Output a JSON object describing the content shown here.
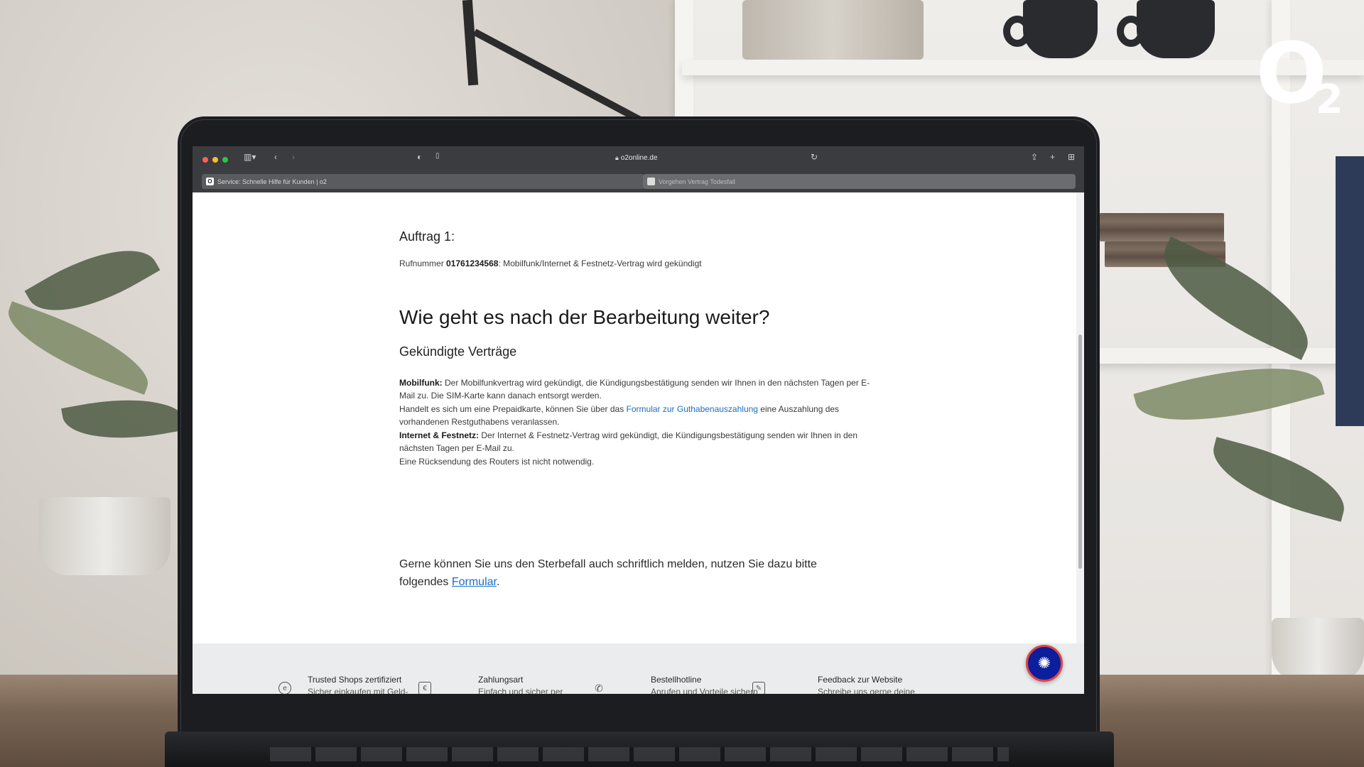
{
  "brand": {
    "logo_letter": "O",
    "logo_subscript": "2",
    "accent_color": "#0b1e9c",
    "link_color": "#1a6ec2"
  },
  "browser": {
    "address": "o2online.de",
    "tabs": [
      {
        "label": "Service: Schnelle Hilfe für Kunden | o2",
        "favicon": "O"
      },
      {
        "label": "Vorgehen Vertrag Todesfall"
      }
    ],
    "icons": [
      "sidebar-icon",
      "back-icon",
      "forward-icon",
      "shield-icon",
      "page-icon",
      "lock-icon",
      "reload-icon",
      "share-icon",
      "new-tab-icon",
      "tab-overview-icon"
    ]
  },
  "content": {
    "auftrag_heading": "Auftrag 1:",
    "rufnummer_prefix": "Rufnummer ",
    "rufnummer_number": "01761234568",
    "rufnummer_suffix": ": Mobilfunk/Internet & Festnetz-Vertrag wird gekündigt",
    "main_heading": "Wie geht es nach der Bearbeitung weiter?",
    "sub_heading": "Gekündigte Verträge",
    "mobilfunk_label": "Mobilfunk:",
    "mobilfunk_text": " Der Mobilfunkvertrag wird gekündigt, die Kündigungsbestätigung senden wir Ihnen in den nächsten Tagen per E-Mail zu. Die SIM-Karte kann danach entsorgt werden.",
    "prepaid_text_before": "Handelt es sich um eine Prepaidkarte, können Sie über das ",
    "prepaid_link": "Formular zur Guthabenauszahlung",
    "prepaid_text_after": " eine Auszahlung des vorhandenen Restguthabens veranlassen.",
    "internet_label": "Internet & Festnetz:",
    "internet_text": " Der Internet & Festnetz-Vertrag wird gekündigt, die Kündigungsbestätigung senden wir Ihnen in den nächsten Tagen per E-Mail zu.",
    "router_text": "Eine Rücksendung des Routers ist nicht notwendig.",
    "gerne_text": "Gerne können Sie uns den Sterbefall auch schriftlich melden, nutzen Sie dazu bitte folgendes ",
    "gerne_link": "Formular",
    "gerne_end": "."
  },
  "footer": {
    "items": [
      {
        "title": "Trusted Shops zertifiziert",
        "sub": "Sicher einkaufen mit Geld-",
        "icon": "trusted-shops-icon"
      },
      {
        "title": "Zahlungsart",
        "sub": "Einfach und sicher per",
        "icon": "euro-icon"
      },
      {
        "title": "Bestellhotline",
        "sub": "Anrufen und Vorteile sichern",
        "icon": "phone-icon"
      },
      {
        "title": "Feedback zur Website",
        "sub": "Schreibe uns gerne deine",
        "icon": "feedback-icon"
      }
    ],
    "chat_icon": "chat-assistant-icon"
  }
}
